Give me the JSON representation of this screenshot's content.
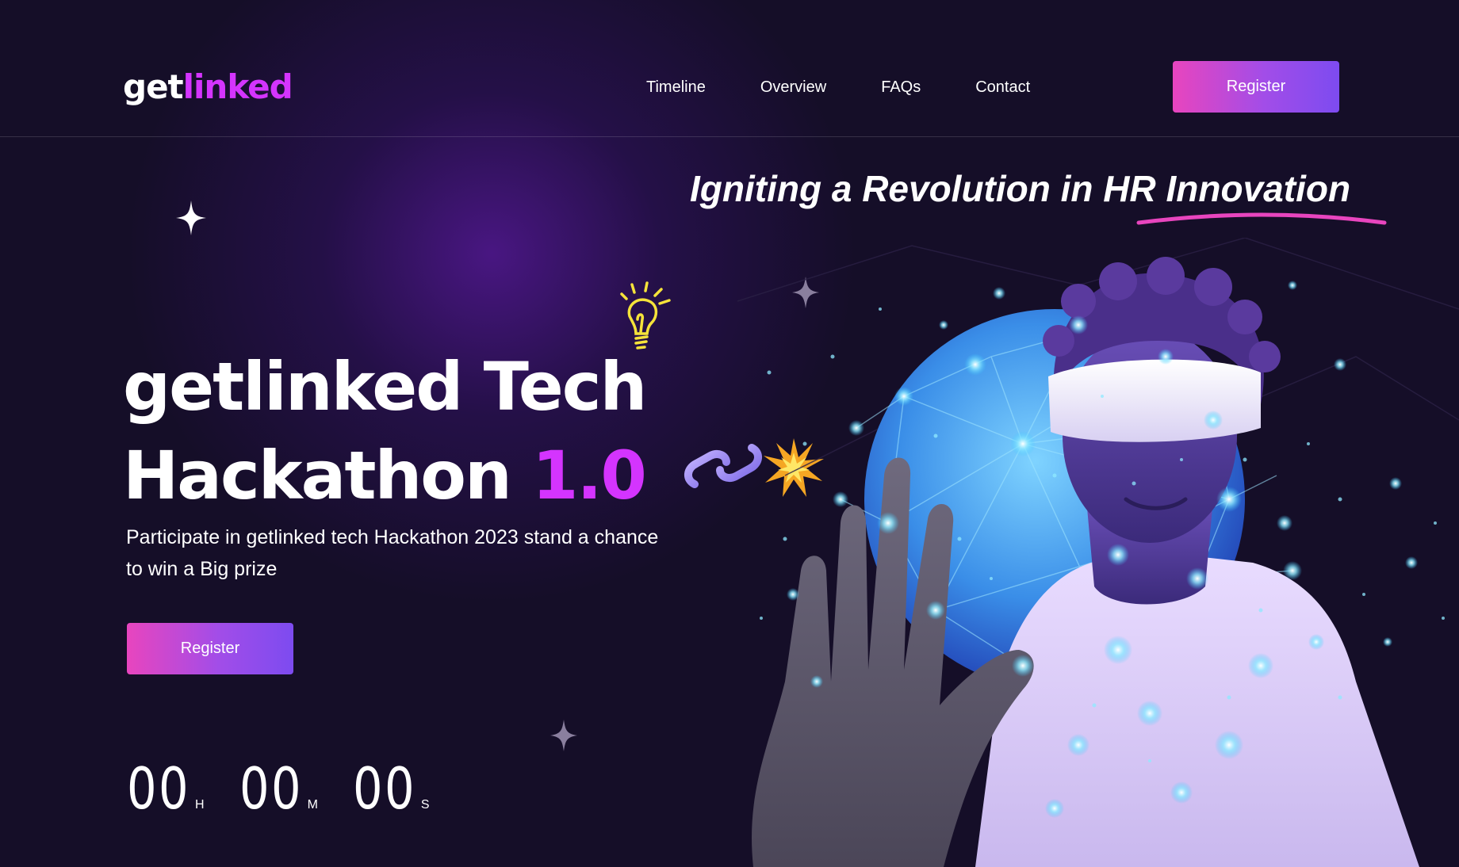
{
  "brand": {
    "logo_part1": "get",
    "logo_part2": "linked",
    "accent_color": "#d434fe"
  },
  "nav": {
    "items": [
      "Timeline",
      "Overview",
      "FAQs",
      "Contact"
    ]
  },
  "header": {
    "register_label": "Register"
  },
  "hero": {
    "tagline": "Igniting a Revolution in HR Innovation",
    "title_line1": "getlinked Tech",
    "title_line2": "Hackathon",
    "title_version": "1.0",
    "description": "Participate in getlinked tech Hackathon 2023 stand a chance to win a Big prize",
    "register_label": "Register",
    "icons": [
      "lightbulb-icon",
      "chain-link-icon",
      "explosion-icon",
      "sparkle-star-icon"
    ]
  },
  "countdown": {
    "hours": "00",
    "hours_label": "H",
    "minutes": "00",
    "minutes_label": "M",
    "seconds": "00",
    "seconds_label": "S"
  },
  "colors": {
    "background": "#150e28",
    "button_gradient_start": "#e845be",
    "button_gradient_end": "#7d4bf0",
    "underline": "#e845be"
  }
}
